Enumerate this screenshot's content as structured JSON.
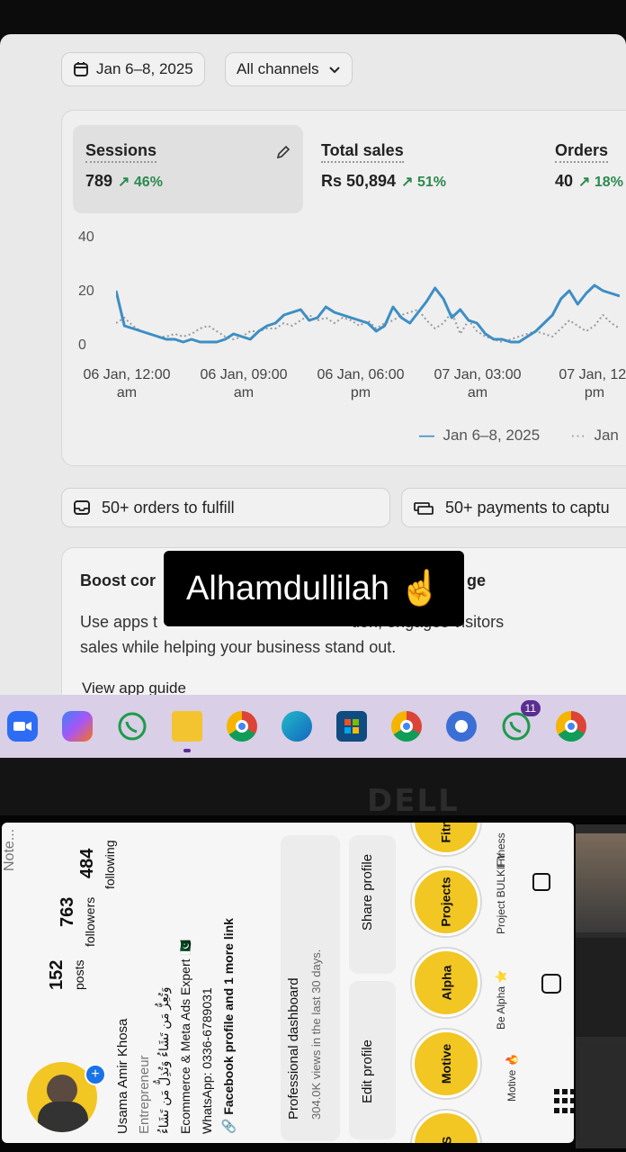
{
  "colors": {
    "accent_line": "#3d8ec4",
    "comparison_line": "#9a9a9a",
    "delta_green": "#2c8a4e",
    "taskbar": "#d9cfe6",
    "highlight_yellow": "#f2c623"
  },
  "filters": {
    "date_range": "Jan 6–8, 2025",
    "channels": "All channels",
    "calendar_icon": "calendar-icon",
    "chevron_icon": "chevron-down-icon"
  },
  "metrics": [
    {
      "label": "Sessions",
      "value": "789",
      "delta": "46%",
      "edit_icon": "pencil-icon"
    },
    {
      "label": "Total sales",
      "value": "Rs 50,894",
      "delta": "51%"
    },
    {
      "label": "Orders",
      "value": "40",
      "delta": "18%"
    }
  ],
  "chart_data": {
    "type": "line",
    "title": "",
    "ylim": [
      0,
      40
    ],
    "y_ticks": [
      "40",
      "20",
      "0"
    ],
    "x_ticks": [
      {
        "line1": "06 Jan, 12:00",
        "line2": "am"
      },
      {
        "line1": "06 Jan, 09:00",
        "line2": "am"
      },
      {
        "line1": "06 Jan, 06:00",
        "line2": "pm"
      },
      {
        "line1": "07 Jan, 03:00",
        "line2": "am"
      },
      {
        "line1": "07 Jan, 12:",
        "line2": "pm"
      }
    ],
    "legend_position": "bottom-right",
    "series": [
      {
        "name": "Jan 6–8, 2025",
        "style": "solid",
        "values": [
          20,
          7,
          6,
          5,
          4,
          3,
          2,
          2,
          1,
          2,
          1,
          1,
          1,
          2,
          4,
          3,
          2,
          5,
          7,
          8,
          11,
          12,
          13,
          9,
          10,
          14,
          12,
          11,
          10,
          9,
          8,
          5,
          7,
          14,
          10,
          8,
          12,
          16,
          21,
          17,
          10,
          13,
          9,
          8,
          4,
          2,
          2,
          1,
          1,
          3,
          5,
          8,
          11,
          17,
          20,
          15,
          19,
          22,
          20,
          19,
          18
        ]
      },
      {
        "name": "Jan",
        "style": "dotted",
        "values": [
          8,
          10,
          7,
          5,
          4,
          3,
          3,
          4,
          3,
          4,
          6,
          7,
          5,
          3,
          2,
          3,
          5,
          5,
          6,
          6,
          8,
          7,
          9,
          11,
          9,
          10,
          8,
          10,
          9,
          7,
          9,
          6,
          8,
          9,
          11,
          12,
          13,
          9,
          6,
          8,
          12,
          4,
          9,
          5,
          3,
          2,
          1,
          2,
          3,
          4,
          5,
          4,
          3,
          6,
          9,
          7,
          5,
          7,
          11,
          8,
          6
        ]
      }
    ]
  },
  "chips": [
    {
      "text": "50+ orders to fulfill",
      "icon": "inbox-icon"
    },
    {
      "text": "50+ payments to captu",
      "icon": "cash-icon"
    }
  ],
  "boost": {
    "title": "Boost cor",
    "title_end": "ge",
    "desc_line1": "Use apps t",
    "desc_line1_end": "tion, engages visitors",
    "desc_line2": "sales while helping your business stand out.",
    "button": "View app guide"
  },
  "overlay_text": "Alhamdullilah ☝️",
  "taskbar_icons": [
    "zoom-icon",
    "copilot-icon",
    "whatsapp-icon",
    "file-explorer-icon",
    "chrome-icon",
    "edge-icon",
    "microsoft-store-icon",
    "chrome-profile-icon",
    "chromium-icon",
    "whatsapp-icon",
    "chrome-profile-icon"
  ],
  "taskbar_badge": "11",
  "brand": "DELL",
  "profile": {
    "name": "Usama Amir Khosa",
    "role": "Entrepreneur",
    "bio_arabic": "وَتُعِزُّ مَن تَشَاءُ وَتُذِلُّ مَن تَشَاءُ",
    "bio_line": "Ecommerce & Meta Ads Expert 🇵🇰",
    "whatsapp": "WhatsApp: 0336-6789031",
    "links": "Facebook profile and 1 more link",
    "note": "Note...",
    "posts": {
      "count": "152",
      "label": "posts"
    },
    "followers": {
      "count": "763",
      "label": "followers"
    },
    "following": {
      "count": "484",
      "label": "following"
    },
    "dashboard_title": "Professional dashboard",
    "dashboard_sub": "304.0K views in the last 30 days.",
    "edit_button": "Edit profile",
    "share_button": "Share profile",
    "highlights": [
      "Motive",
      "Alpha",
      "Projects",
      "Fitness"
    ],
    "highlight_captions": [
      "Motive 🔥",
      "Be Alpha ⭐",
      "Project BULKIFY",
      "Fitness"
    ],
    "partial_highlight": "ES"
  }
}
